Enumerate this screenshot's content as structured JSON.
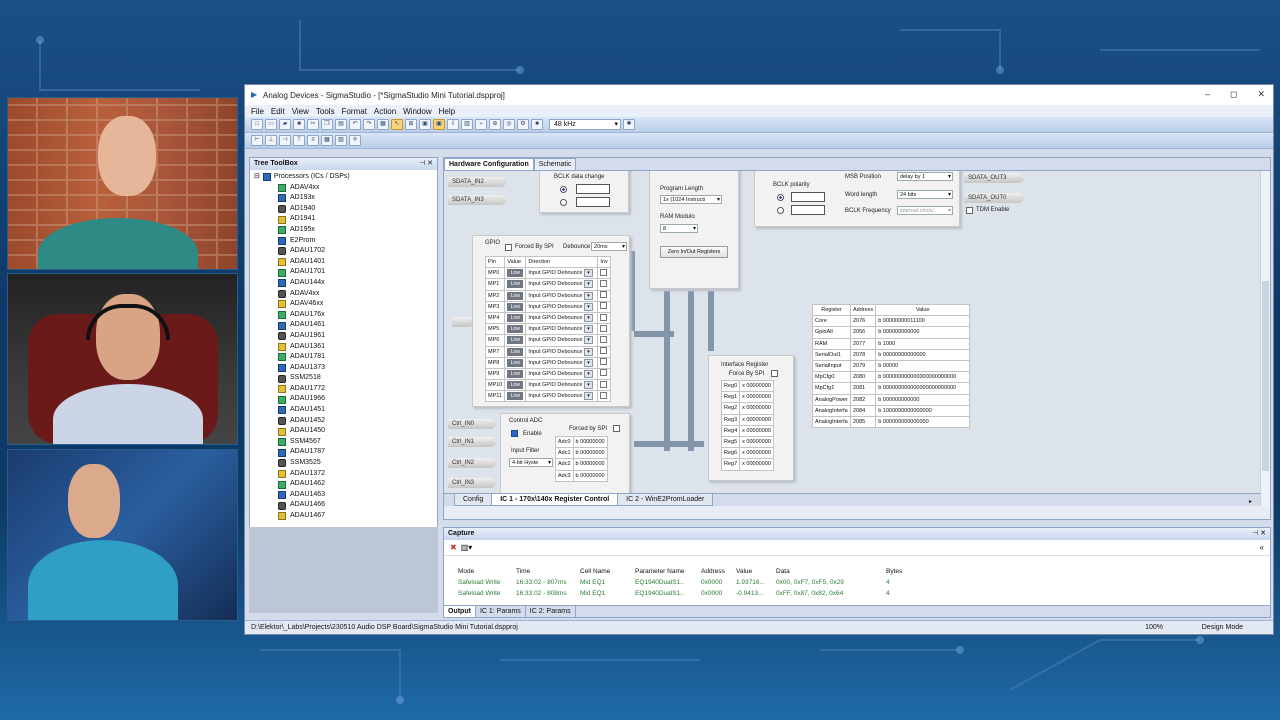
{
  "window": {
    "title": "Analog Devices - SigmaStudio - [*SigmaStudio Mini Tutorial.dspproj]",
    "controls": [
      "–",
      "◻",
      "✕"
    ]
  },
  "menu": [
    "File",
    "Edit",
    "View",
    "Tools",
    "Format",
    "Action",
    "Window",
    "Help"
  ],
  "toolbar": {
    "sample_rate": "48 kHz"
  },
  "toolbox": {
    "title": "Tree ToolBox",
    "root": "Processors (ICs / DSPs)",
    "items": [
      "ADAV4xx",
      "AD193x",
      "AD1940",
      "AD1941",
      "AD195x",
      "E2Prom",
      "ADAU1702",
      "ADAU1401",
      "ADAU1701",
      "ADAU144x",
      "ADAV4xx",
      "ADAV46xx",
      "ADAU176x",
      "ADAU1461",
      "ADAU1961",
      "ADAU1361",
      "ADAU1781",
      "ADAU1373",
      "SSM2518",
      "ADAU1772",
      "ADAU1966",
      "ADAU1451",
      "ADAU1452",
      "ADAU1450",
      "SSM4567",
      "ADAU1787",
      "SSM3525",
      "ADAU1372",
      "ADAU1462",
      "ADAU1463",
      "ADAU1466",
      "ADAU1467"
    ]
  },
  "doc_tabs": [
    "Hardware Configuration",
    "Schematic"
  ],
  "canvas": {
    "sdata_in": [
      "SDATA_IN2",
      "SDATA_IN3"
    ],
    "bclk_data_change": "BCLK data change",
    "program_length": "Program Length",
    "program_length_val": "1x (1024 Instructi",
    "ram_modulo": "RAM Modulo",
    "ram_modulo_val": "8",
    "zero_btn": "Zero In/Out Registers",
    "bclk_polarity": "BCLK polarity",
    "msb_position": "MSB Position",
    "msb_val": "delay by 1",
    "word_length": "Word length",
    "word_val": "24 bits",
    "bclk_freq": "BCLK Frequency",
    "bclk_freq_val": "internal clock/..",
    "sdata_out": [
      "SDATA_OUT3",
      "SDATA_OUT0"
    ],
    "tdm_enable": "TDM Enable",
    "gpio": {
      "title": "GPIO",
      "forced": "Forced By SPI",
      "debounce": "Debounce",
      "debounce_val": "20ms",
      "headers": [
        "Pin",
        "Value",
        "Direction",
        "Inv"
      ],
      "rows": [
        {
          "pin": "MP0",
          "value": "Low",
          "dir": "Input GPIO Debounce"
        },
        {
          "pin": "MP1",
          "value": "Low",
          "dir": "Input GPIO Debounce"
        },
        {
          "pin": "MP2",
          "value": "Low",
          "dir": "Input GPIO Debounce"
        },
        {
          "pin": "MP3",
          "value": "Low",
          "dir": "Input GPIO Debounce"
        },
        {
          "pin": "MP4",
          "value": "Low",
          "dir": "Input GPIO Debounce"
        },
        {
          "pin": "MP5",
          "value": "Low",
          "dir": "Input GPIO Debounce"
        },
        {
          "pin": "MP6",
          "value": "Low",
          "dir": "Input GPIO Debounce"
        },
        {
          "pin": "MP7",
          "value": "Low",
          "dir": "Input GPIO Debounce"
        },
        {
          "pin": "MP8",
          "value": "Low",
          "dir": "Input GPIO Debounce"
        },
        {
          "pin": "MP9",
          "value": "Low",
          "dir": "Input GPIO Debounce"
        },
        {
          "pin": "MP10",
          "value": "Low",
          "dir": "Input GPIO Debounce"
        },
        {
          "pin": "MP11",
          "value": "Low",
          "dir": "Input GPIO Debounce"
        }
      ]
    },
    "ctrl_in": [
      "Ctrl_IN0",
      "Ctrl_IN1",
      "Ctrl_IN2",
      "Ctrl_IN3"
    ],
    "adc": {
      "title": "Control ADC",
      "enable": "Enable",
      "forced": "Forced by SPI",
      "filter_label": "Input Filter",
      "filter_val": "4-bit Hyste",
      "rows": [
        [
          "Adc0",
          "b 00000000"
        ],
        [
          "Adc1",
          "b 00000000"
        ],
        [
          "Adc2",
          "b 00000000"
        ],
        [
          "Adc3",
          "b 00000000"
        ]
      ]
    },
    "iface": {
      "title": "Interface Register",
      "forced": "Force By SPI",
      "rows": [
        [
          "Reg0",
          "x 00000000"
        ],
        [
          "Reg1",
          "x 00000000"
        ],
        [
          "Reg2",
          "x 00000000"
        ],
        [
          "Reg3",
          "x 00000000"
        ],
        [
          "Reg4",
          "x 00000000"
        ],
        [
          "Reg5",
          "x 00000000"
        ],
        [
          "Reg6",
          "x 00000000"
        ],
        [
          "Reg7",
          "x 00000000"
        ]
      ]
    },
    "reg_table": {
      "headers": [
        "Register",
        "Address",
        "Value"
      ],
      "rows": [
        [
          "Core",
          "2076",
          "b 00000000011100"
        ],
        [
          "GpioAll",
          "2056",
          "b 000000000000"
        ],
        [
          "RAM",
          "2077",
          "b 1000"
        ],
        [
          "SerialOut1",
          "2078",
          "b 00000000000000"
        ],
        [
          "SerialInput",
          "2079",
          "b 00000"
        ],
        [
          "MpCfg0",
          "2080",
          "b 000000000000000000000000"
        ],
        [
          "MpCfg1",
          "2081",
          "b 000000000000000000000000"
        ],
        [
          "AnalogPower",
          "2082",
          "b 000000000000"
        ],
        [
          "AnalogInterfa",
          "2084",
          "b 1000000000000000"
        ],
        [
          "AnalogInterfa",
          "2085",
          "b 000000000000000"
        ]
      ]
    }
  },
  "bottom_tabs": [
    "Config",
    "IC 1 - 170x\\140x Register Control",
    "IC 2 - WinE2PromLoader"
  ],
  "capture": {
    "title": "Capture",
    "headers": [
      "Mode",
      "Time",
      "Cell Name",
      "Parameter Name",
      "Address",
      "Value",
      "Data",
      "Bytes"
    ],
    "rows": [
      [
        "Safeload Write",
        "16:33:02 - 807ms",
        "Mid EQ1",
        "EQ1940DualS1..",
        "0x0000",
        "1.93716...",
        "0x00, 0xF7, 0xF5, 0x29",
        "4"
      ],
      [
        "Safeload Write",
        "16:33:02 - 808ms",
        "Mid EQ1",
        "EQ1940DualS1..",
        "0x0000",
        "-0.9413...",
        "0xFF, 0x87, 0x82, 0x64",
        "4"
      ]
    ],
    "tabs": [
      "Output",
      "IC 1: Params",
      "IC 2: Params"
    ]
  },
  "status": {
    "path": "D:\\Elektor\\_Labs\\Projects\\230510 Audio DSP Board\\SigmaStudio Mini Tutorial.dspproj",
    "zoom": "100%",
    "mode": "Design Mode"
  }
}
